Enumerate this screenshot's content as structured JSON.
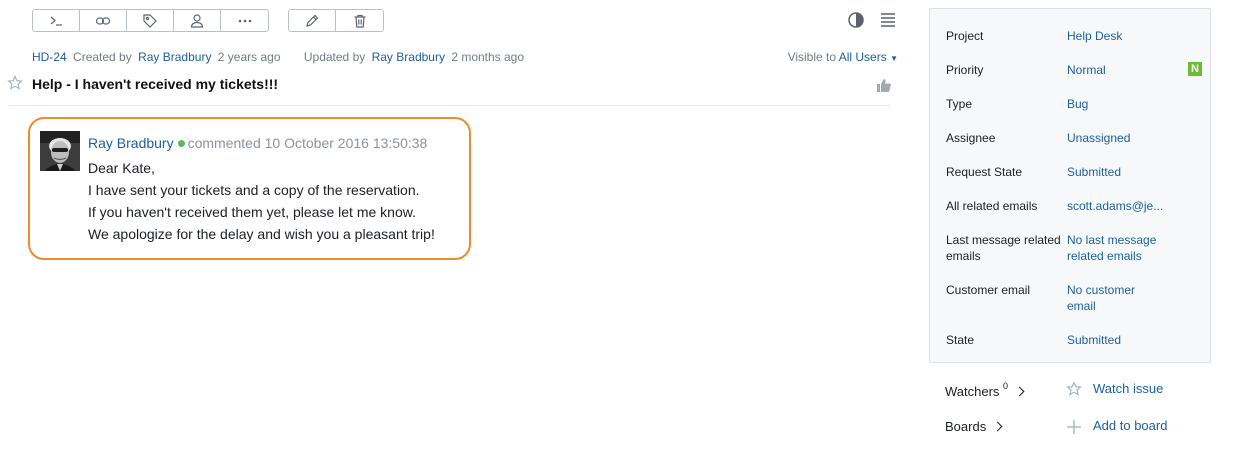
{
  "toolbar": {
    "group1": [
      {
        "icon": "command-icon",
        "label": ""
      },
      {
        "icon": "link-icon",
        "label": ""
      },
      {
        "icon": "tag-icon",
        "label": ""
      },
      {
        "icon": "user-icon",
        "label": ""
      },
      {
        "icon": "more-icon",
        "label": ""
      }
    ],
    "group2": [
      {
        "icon": "pencil-icon",
        "label": ""
      },
      {
        "icon": "trash-icon",
        "label": ""
      }
    ]
  },
  "issue": {
    "id": "HD-24",
    "created_prefix": "Created by",
    "created_by": "Ray Bradbury",
    "created_ago": "2 years ago",
    "updated_prefix": "Updated by",
    "updated_by": "Ray Bradbury",
    "updated_ago": "2 months ago",
    "visible_prefix": "Visible to",
    "visible_to": "All Users",
    "title": "Help - I haven't received my tickets!!!"
  },
  "comment": {
    "author": "Ray Bradbury",
    "action": "commented",
    "timestamp": "10 October 2016 13:50:38",
    "lines": [
      "Dear Kate,",
      "I have sent your tickets and a copy of the reservation.",
      "If you haven't received them yet, please let me know.",
      "We apologize for the delay and wish you a pleasant trip!"
    ]
  },
  "fields": [
    {
      "label": "Project",
      "value": "Help Desk"
    },
    {
      "label": "Priority",
      "value": "Normal",
      "badge": "N"
    },
    {
      "label": "Type",
      "value": "Bug"
    },
    {
      "label": "Assignee",
      "value": "Unassigned"
    },
    {
      "label": "Request State",
      "value": "Submitted"
    },
    {
      "label": "All related emails",
      "value": "scott.adams@je..."
    },
    {
      "label": "Last message related emails",
      "value": "No last message related emails"
    },
    {
      "label": "Customer email",
      "value": "No customer email"
    },
    {
      "label": "State",
      "value": "Submitted"
    }
  ],
  "sidebar": {
    "watchers_label": "Watchers",
    "watchers_count": "0",
    "watch_action": "Watch issue",
    "boards_label": "Boards",
    "board_action": "Add to board"
  },
  "colors": {
    "accent": "#1b5f9c",
    "highlight_border": "#ee8a2f",
    "online": "#5cb85c",
    "priority_badge": "#6dbb2e"
  }
}
